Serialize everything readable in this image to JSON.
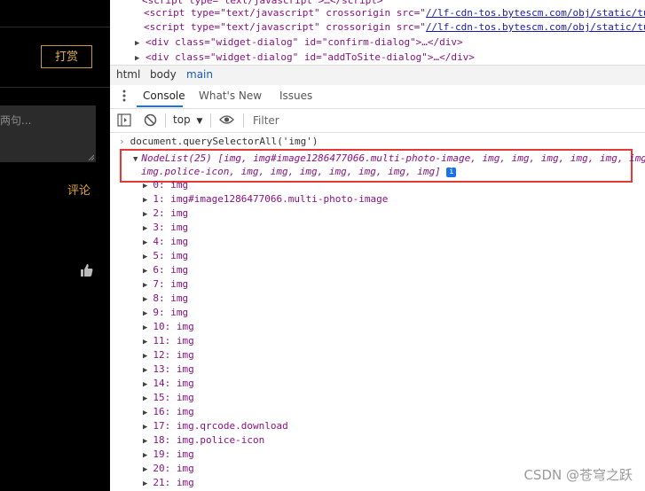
{
  "left_page": {
    "reward_button": "打赏",
    "comment_placeholder": "两句...",
    "comment_link": "评论"
  },
  "source_lines": [
    {
      "pre": "<script type=\"text/javascript\" crossorigin src=\"",
      "link": "//lf-cdn-tos.bytescm.com/obj/static/tu"
    },
    {
      "pre": "<script type=\"text/javascript\" crossorigin src=\"",
      "link": "//lf-cdn-tos.bytescm.com/obj/static/tu"
    },
    {
      "text": "<div class=\"widget-dialog\" id=\"confirm-dialog\">…</div>"
    },
    {
      "text": "<div class=\"widget-dialog\" id=\"addToSite-dialog\">…</div>"
    }
  ],
  "breadcrumbs": [
    "html",
    "body",
    "main"
  ],
  "drawer_tabs": [
    "Console",
    "What's New",
    "Issues"
  ],
  "toolbar": {
    "context": "top",
    "filter_placeholder": "Filter"
  },
  "console": {
    "command": "document.querySelectorAll('img')",
    "nodelist_line1": "NodeList(25) [img, img#image1286477066.multi-photo-image, img, img, img, img, img, img",
    "nodelist_line2": "img.police-icon, img, img, img, img, img, img, img]",
    "entries": [
      {
        "index": "0:",
        "value": "img"
      },
      {
        "index": "1:",
        "value": "img#image1286477066.multi-photo-image"
      },
      {
        "index": "2:",
        "value": "img"
      },
      {
        "index": "3:",
        "value": "img"
      },
      {
        "index": "4:",
        "value": "img"
      },
      {
        "index": "5:",
        "value": "img"
      },
      {
        "index": "6:",
        "value": "img"
      },
      {
        "index": "7:",
        "value": "img"
      },
      {
        "index": "8:",
        "value": "img"
      },
      {
        "index": "9:",
        "value": "img"
      },
      {
        "index": "10:",
        "value": "img"
      },
      {
        "index": "11:",
        "value": "img"
      },
      {
        "index": "12:",
        "value": "img"
      },
      {
        "index": "13:",
        "value": "img"
      },
      {
        "index": "14:",
        "value": "img"
      },
      {
        "index": "15:",
        "value": "img"
      },
      {
        "index": "16:",
        "value": "img"
      },
      {
        "index": "17:",
        "value": "img.qrcode.download"
      },
      {
        "index": "18:",
        "value": "img.police-icon"
      },
      {
        "index": "19:",
        "value": "img"
      },
      {
        "index": "20:",
        "value": "img"
      },
      {
        "index": "21:",
        "value": "img"
      }
    ]
  },
  "watermark": "CSDN @苍穹之跃",
  "colors": {
    "highlight_box": "#e53935",
    "tab_underline": "#1a73e8",
    "accent_gold": "#e0a73c"
  }
}
